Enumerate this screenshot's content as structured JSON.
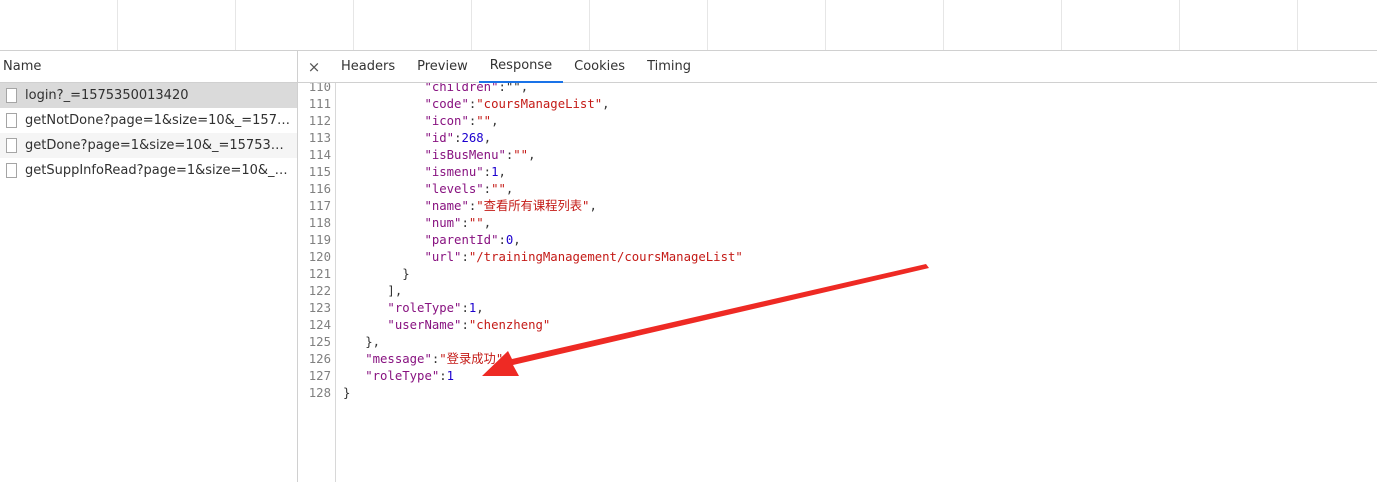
{
  "network": {
    "columns": {
      "name": "Name"
    },
    "requests": [
      {
        "name": "login?_=1575350013420",
        "selected": true
      },
      {
        "name": "getNotDone?page=1&size=10&_=1575..."
      },
      {
        "name": "getDone?page=1&size=10&_=1575350..."
      },
      {
        "name": "getSuppInfoRead?page=1&size=10&_=..."
      }
    ]
  },
  "detail_tabs": {
    "close": "×",
    "items": [
      {
        "label": "Headers"
      },
      {
        "label": "Preview"
      },
      {
        "label": "Response",
        "active": true
      },
      {
        "label": "Cookies"
      },
      {
        "label": "Timing"
      }
    ]
  },
  "response": {
    "lines": [
      {
        "num": "110",
        "indent": 11,
        "segs": [
          [
            "k",
            "\"children\""
          ],
          [
            "p",
            ":\"\","
          ]
        ]
      },
      {
        "num": "111",
        "indent": 11,
        "segs": [
          [
            "k",
            "\"code\""
          ],
          [
            "p",
            ":"
          ],
          [
            "s",
            "\"coursManageList\""
          ],
          [
            "p",
            ","
          ]
        ]
      },
      {
        "num": "112",
        "indent": 11,
        "segs": [
          [
            "k",
            "\"icon\""
          ],
          [
            "p",
            ":"
          ],
          [
            "s",
            "\"\""
          ],
          [
            "p",
            ","
          ]
        ]
      },
      {
        "num": "113",
        "indent": 11,
        "segs": [
          [
            "k",
            "\"id\""
          ],
          [
            "p",
            ":"
          ],
          [
            "n",
            "268"
          ],
          [
            "p",
            ","
          ]
        ]
      },
      {
        "num": "114",
        "indent": 11,
        "segs": [
          [
            "k",
            "\"isBusMenu\""
          ],
          [
            "p",
            ":"
          ],
          [
            "s",
            "\"\""
          ],
          [
            "p",
            ","
          ]
        ]
      },
      {
        "num": "115",
        "indent": 11,
        "segs": [
          [
            "k",
            "\"ismenu\""
          ],
          [
            "p",
            ":"
          ],
          [
            "n",
            "1"
          ],
          [
            "p",
            ","
          ]
        ]
      },
      {
        "num": "116",
        "indent": 11,
        "segs": [
          [
            "k",
            "\"levels\""
          ],
          [
            "p",
            ":"
          ],
          [
            "s",
            "\"\""
          ],
          [
            "p",
            ","
          ]
        ]
      },
      {
        "num": "117",
        "indent": 11,
        "segs": [
          [
            "k",
            "\"name\""
          ],
          [
            "p",
            ":"
          ],
          [
            "s",
            "\"查看所有课程列表\""
          ],
          [
            "p",
            ","
          ]
        ]
      },
      {
        "num": "118",
        "indent": 11,
        "segs": [
          [
            "k",
            "\"num\""
          ],
          [
            "p",
            ":"
          ],
          [
            "s",
            "\"\""
          ],
          [
            "p",
            ","
          ]
        ]
      },
      {
        "num": "119",
        "indent": 11,
        "segs": [
          [
            "k",
            "\"parentId\""
          ],
          [
            "p",
            ":"
          ],
          [
            "n",
            "0"
          ],
          [
            "p",
            ","
          ]
        ]
      },
      {
        "num": "120",
        "indent": 11,
        "segs": [
          [
            "k",
            "\"url\""
          ],
          [
            "p",
            ":"
          ],
          [
            "s",
            "\"/trainingManagement/coursManageList\""
          ]
        ]
      },
      {
        "num": "121",
        "indent": 8,
        "segs": [
          [
            "p",
            "}"
          ]
        ]
      },
      {
        "num": "122",
        "indent": 6,
        "segs": [
          [
            "p",
            "],"
          ]
        ]
      },
      {
        "num": "123",
        "indent": 6,
        "segs": [
          [
            "k",
            "\"roleType\""
          ],
          [
            "p",
            ":"
          ],
          [
            "n",
            "1"
          ],
          [
            "p",
            ","
          ]
        ]
      },
      {
        "num": "124",
        "indent": 6,
        "segs": [
          [
            "k",
            "\"userName\""
          ],
          [
            "p",
            ":"
          ],
          [
            "s",
            "\"chenzheng\""
          ]
        ]
      },
      {
        "num": "125",
        "indent": 3,
        "segs": [
          [
            "p",
            "},"
          ]
        ]
      },
      {
        "num": "126",
        "indent": 3,
        "segs": [
          [
            "k",
            "\"message\""
          ],
          [
            "p",
            ":"
          ],
          [
            "s",
            "\"登录成功\""
          ],
          [
            "p",
            ","
          ]
        ]
      },
      {
        "num": "127",
        "indent": 3,
        "segs": [
          [
            "k",
            "\"roleType\""
          ],
          [
            "p",
            ":"
          ],
          [
            "n",
            "1"
          ]
        ]
      },
      {
        "num": "128",
        "indent": 0,
        "segs": [
          [
            "p",
            "}"
          ]
        ]
      }
    ]
  },
  "annotation": {
    "color": "#ee2a24"
  }
}
